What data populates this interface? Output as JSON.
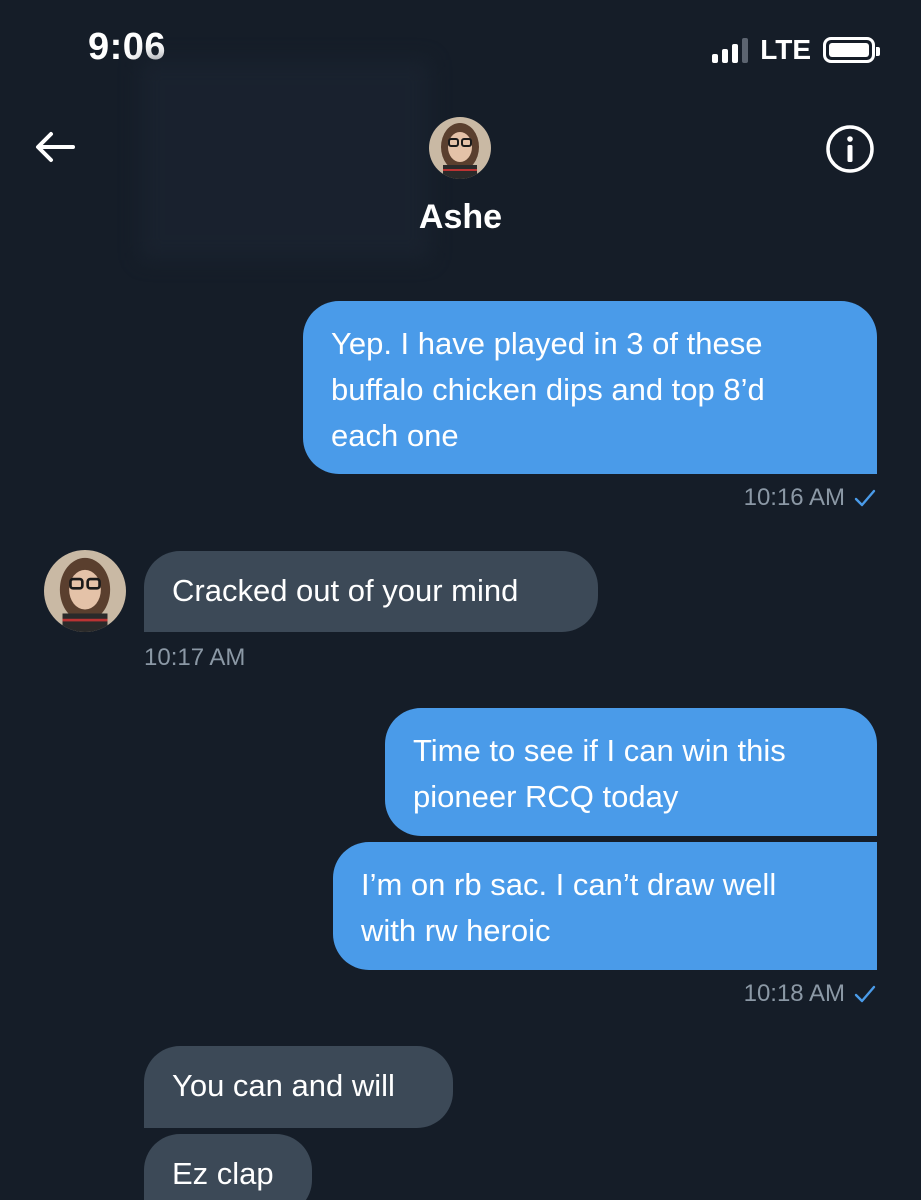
{
  "status_bar": {
    "time": "9:06",
    "network": "LTE"
  },
  "header": {
    "contact_name": "Ashe",
    "back_icon": "arrow-left-icon",
    "info_icon": "info-circle-icon"
  },
  "messages": [
    {
      "direction": "out",
      "text": "Yep. I have played in 3 of these\nbuffalo chicken dips and top 8’d\neach one"
    },
    {
      "direction": "in",
      "text": "Cracked out of your mind"
    },
    {
      "direction": "out",
      "text": "Time to see if I can win this\npioneer RCQ today"
    },
    {
      "direction": "out",
      "text": "I’m on rb sac. I can’t draw well\nwith rw heroic"
    },
    {
      "direction": "in",
      "text": "You can and will"
    },
    {
      "direction": "in",
      "text": "Ez clap"
    }
  ],
  "timestamps": {
    "t1": "10:16 AM",
    "t2": "10:17 AM",
    "t3": "10:18 AM"
  },
  "colors": {
    "background": "#151d28",
    "outgoing_bubble": "#4a9be9",
    "incoming_bubble": "#3c4957",
    "meta_text": "#8b98a5",
    "read_check": "#4a9be9"
  }
}
